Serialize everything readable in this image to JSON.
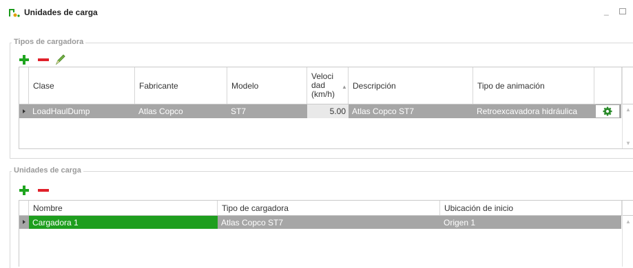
{
  "window": {
    "title": "Unidades de carga"
  },
  "loader_types": {
    "group_label": "Tipos de cargadora",
    "columns": [
      "Clase",
      "Fabricante",
      "Modelo",
      "Veloci\ndad\n(km/h)",
      "Descripción",
      "Tipo de animación"
    ],
    "rows": [
      {
        "clase": "LoadHaulDump",
        "fabricante": "Atlas Copco",
        "modelo": "ST7",
        "velocidad": "5.00",
        "descripcion": "Atlas Copco ST7",
        "animacion": "Retroexcavadora hidráulica"
      }
    ]
  },
  "load_units": {
    "group_label": "Unidades de carga",
    "columns": [
      "Nombre",
      "Tipo de cargadora",
      "Ubicación de inicio"
    ],
    "rows": [
      {
        "nombre": "Cargadora 1",
        "tipo": "Atlas Copco ST7",
        "ubicacion": "Origen 1"
      }
    ]
  },
  "colors": {
    "accent_green": "#1fa51f",
    "delete_red": "#e0202a",
    "selected_row": "#a6a6a6",
    "name_cell": "#1e9e1e"
  }
}
